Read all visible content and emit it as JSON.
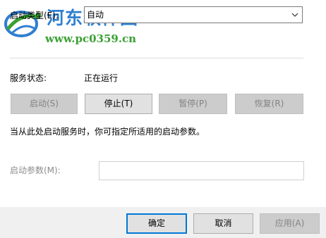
{
  "watermark": {
    "title": "河东软件园",
    "url": "www.pc0359.cn"
  },
  "startup_type": {
    "label": "启动类型(E):",
    "value": "自动"
  },
  "service_status": {
    "label": "服务状态:",
    "value": "正在运行"
  },
  "control_buttons": {
    "start": "启动(S)",
    "stop": "停止(T)",
    "pause": "暂停(P)",
    "resume": "恢复(R)"
  },
  "hint_text": "当从此处启动服务时，你可指定所适用的启动参数。",
  "start_params": {
    "label": "启动参数(M):",
    "value": ""
  },
  "footer_buttons": {
    "ok": "确定",
    "cancel": "取消",
    "apply": "应用(A)"
  },
  "colors": {
    "accent": "#0078d7",
    "watermark_blue": "#2f7fd0",
    "watermark_green": "#3aa034"
  }
}
